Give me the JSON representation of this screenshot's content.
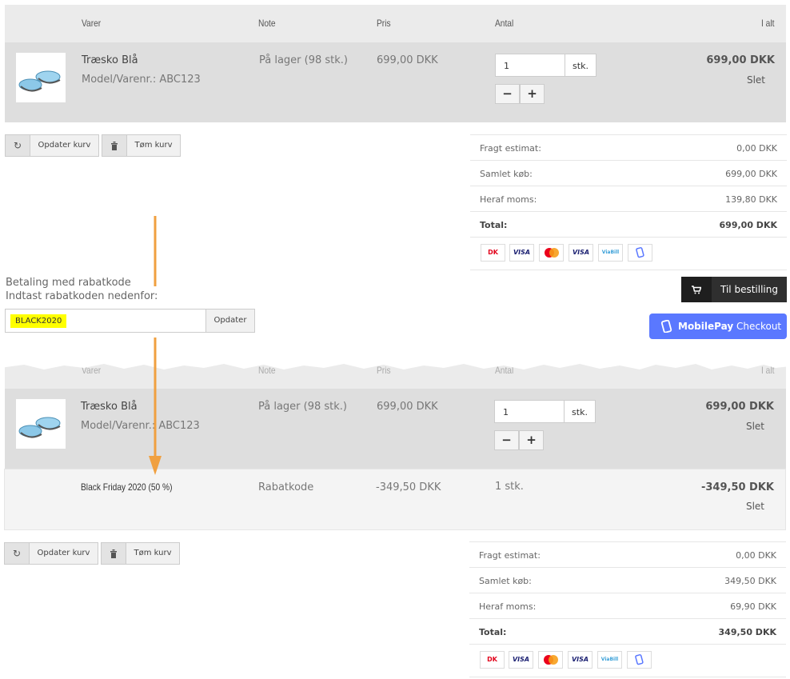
{
  "headers": {
    "varer": "Varer",
    "note": "Note",
    "pris": "Pris",
    "antal": "Antal",
    "ialt": "I alt"
  },
  "product": {
    "title": "Træsko Blå",
    "model": "Model/Varenr.: ABC123",
    "note": "På lager (98 stk.)",
    "price": "699,00 DKK",
    "qty": "1",
    "unit": "stk.",
    "minus": "−",
    "plus": "+",
    "total": "699,00 DKK",
    "delete": "Slet"
  },
  "discount": {
    "title": "Black Friday 2020 (50 %)",
    "note": "Rabatkode",
    "price": "-349,50 DKK",
    "qty": "1 stk.",
    "total": "-349,50 DKK",
    "delete": "Slet"
  },
  "buttons": {
    "update_cart": "Opdater kurv",
    "empty_cart": "Tøm kurv"
  },
  "totals_before": {
    "shipping_label": "Fragt estimat:",
    "shipping": "0,00 DKK",
    "subtotal_label": "Samlet køb:",
    "subtotal": "699,00 DKK",
    "vat_label": "Heraf moms:",
    "vat": "139,80 DKK",
    "total_label": "Total:",
    "total": "699,00 DKK"
  },
  "totals_after": {
    "shipping_label": "Fragt estimat:",
    "shipping": "0,00 DKK",
    "subtotal_label": "Samlet køb:",
    "subtotal": "349,50 DKK",
    "vat_label": "Heraf moms:",
    "vat": "69,90 DKK",
    "total_label": "Total:",
    "total": "349,50 DKK"
  },
  "payment_cards": [
    "Dankort",
    "VISA",
    "mastercard",
    "VISA",
    "ViaBill",
    "MobilePay"
  ],
  "coupon": {
    "heading": "Betaling med rabatkode",
    "instruction": "Indtast rabatkoden nedenfor:",
    "value": "BLACK2020",
    "apply": "Opdater"
  },
  "checkout": {
    "order": "Til bestilling",
    "mobilepay_bold": "MobilePay",
    "mobilepay_rest": " Checkout"
  },
  "colors": {
    "arrow": "#f0a040",
    "mobilepay": "#5a78ff",
    "highlight": "#ffff00"
  }
}
